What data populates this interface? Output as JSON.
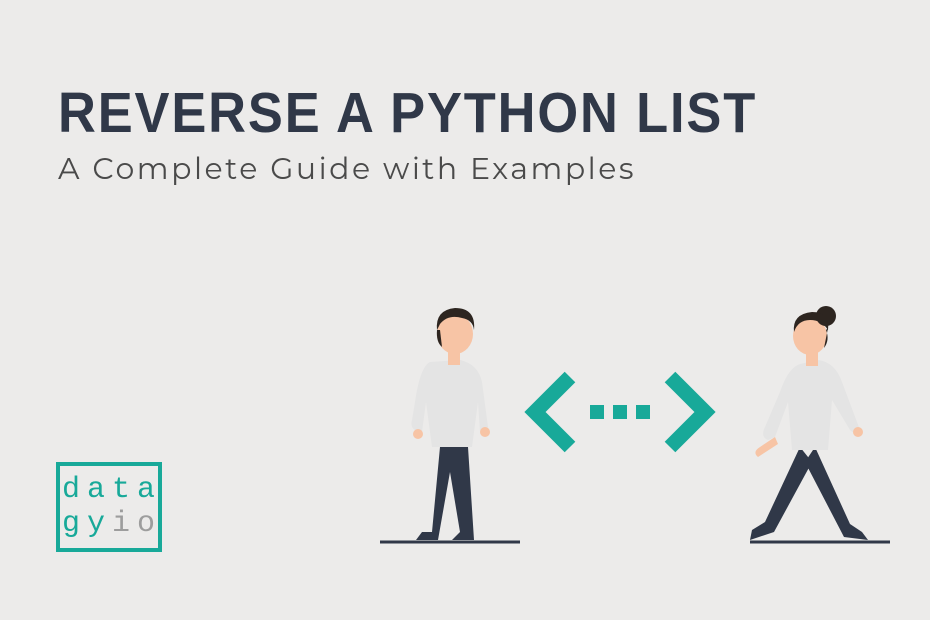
{
  "title": "REVERSE A PYTHON LIST",
  "subtitle": "A Complete Guide with Examples",
  "logo": {
    "line1_accent": "data",
    "line2_accent": "gy",
    "line2_grey": "io"
  },
  "colors": {
    "accent": "#18a999",
    "text_dark": "#303848",
    "text_medium": "#4a4a4a",
    "text_grey": "#9d9d9d",
    "background": "#ecebea"
  },
  "illustration": {
    "description": "Two people facing each other with angle brackets and dots between them",
    "left_bracket": "left-chevron-icon",
    "right_bracket": "right-chevron-icon",
    "dots": "ellipsis-icon"
  }
}
